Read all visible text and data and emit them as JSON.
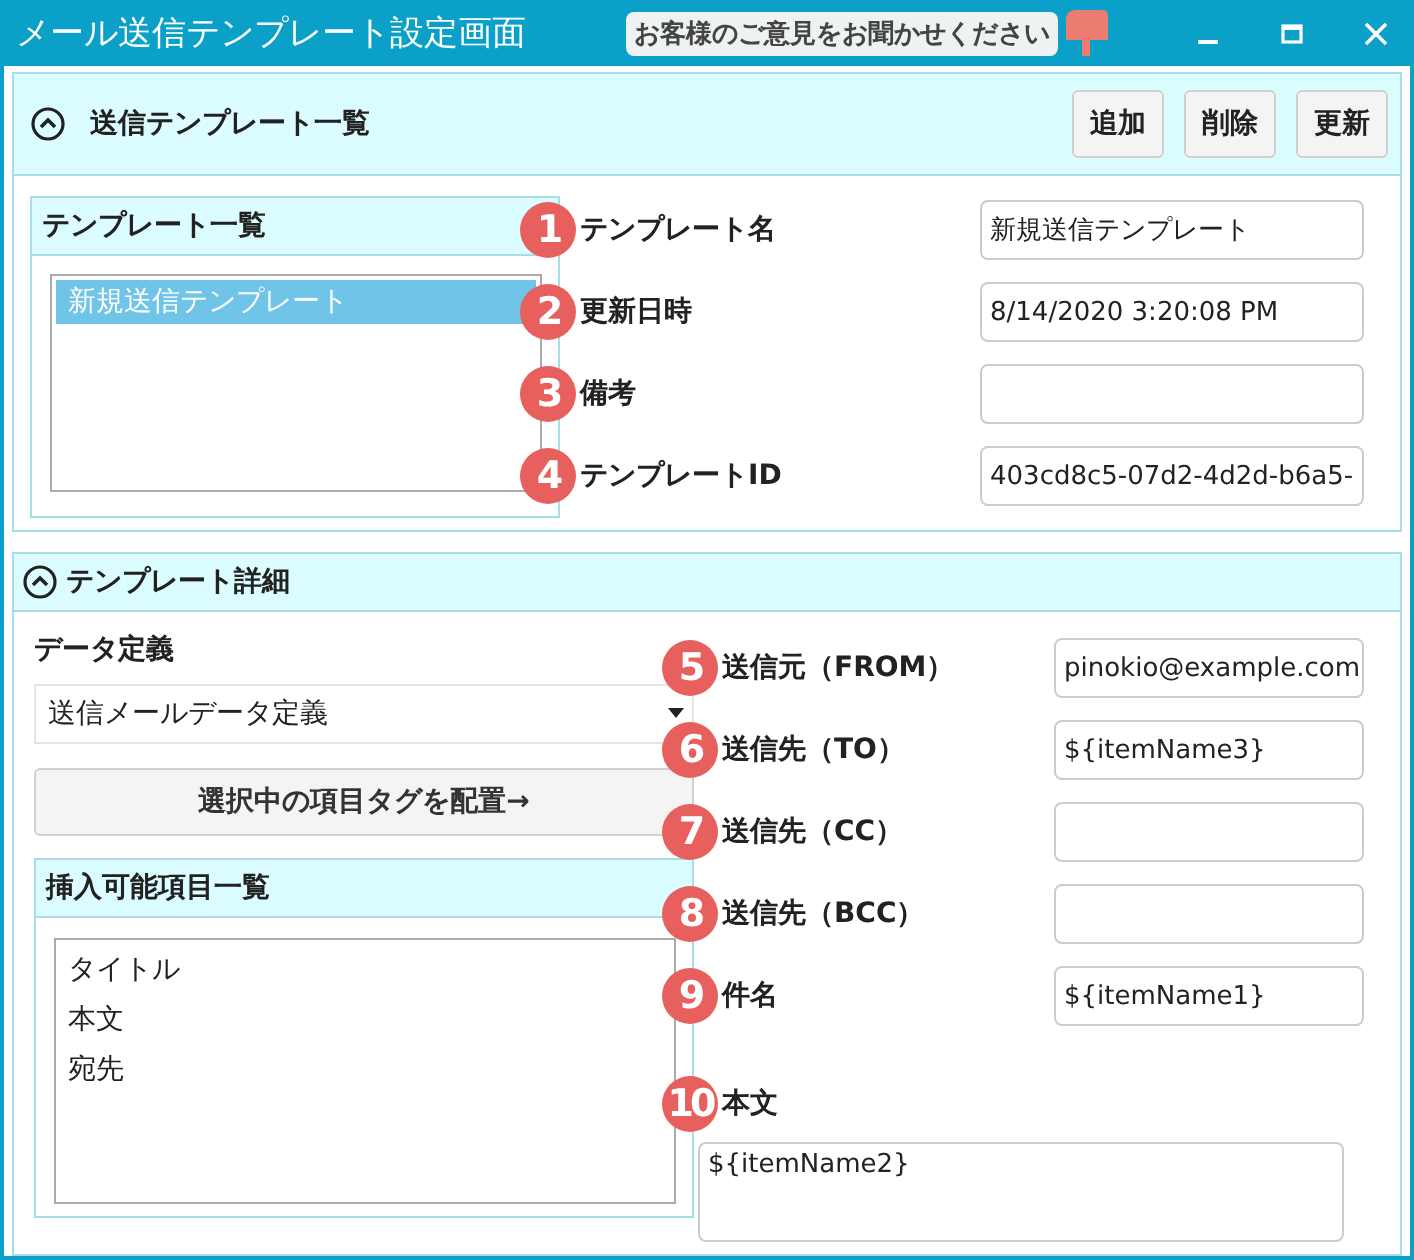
{
  "window": {
    "title": "メール送信テンプレート設定画面",
    "feedback_prompt": "お客様のご意見をお聞かせください"
  },
  "template_list_section": {
    "title": "送信テンプレート一覧",
    "expanded": true,
    "buttons": [
      "追加",
      "削除",
      "更新"
    ],
    "list": {
      "title": "テンプレート一覧",
      "items": [
        {
          "label": "新規送信テンプレート",
          "selected": true
        }
      ]
    },
    "fields": [
      {
        "number": "1",
        "label": "テンプレート名",
        "value": "新規送信テンプレート"
      },
      {
        "number": "2",
        "label": "更新日時",
        "value": "8/14/2020 3:20:08 PM"
      },
      {
        "number": "3",
        "label": "備考"
      },
      {
        "number": "4",
        "label": "テンプレートID",
        "value": "403cd8c5-07d2-4d2d-b6a5-"
      }
    ]
  },
  "detail_section": {
    "title": "テンプレート詳細",
    "expanded": true,
    "data_definition": {
      "label": "データ定義",
      "value": "送信メールデータ定義"
    },
    "place_button": "選択中の項目タグを配置→",
    "insert_list": {
      "title": "挿入可能項目一覧",
      "items": [
        {
          "label": "タイトル",
          "selected": false
        },
        {
          "label": "本文",
          "selected": false
        },
        {
          "label": "宛先",
          "selected": false
        }
      ]
    },
    "fields": [
      {
        "number": "5",
        "label": "送信元（FROM）",
        "value": "pinokio@example.com"
      },
      {
        "number": "6",
        "label": "送信先（TO）",
        "value": "${itemName3}"
      },
      {
        "number": "7",
        "label": "送信先（CC）"
      },
      {
        "number": "8",
        "label": "送信先（BCC）"
      },
      {
        "number": "9",
        "label": "件名",
        "value": "${itemName1}"
      }
    ],
    "body": {
      "number": "10",
      "label": "本文",
      "value": "${itemName2}"
    }
  }
}
